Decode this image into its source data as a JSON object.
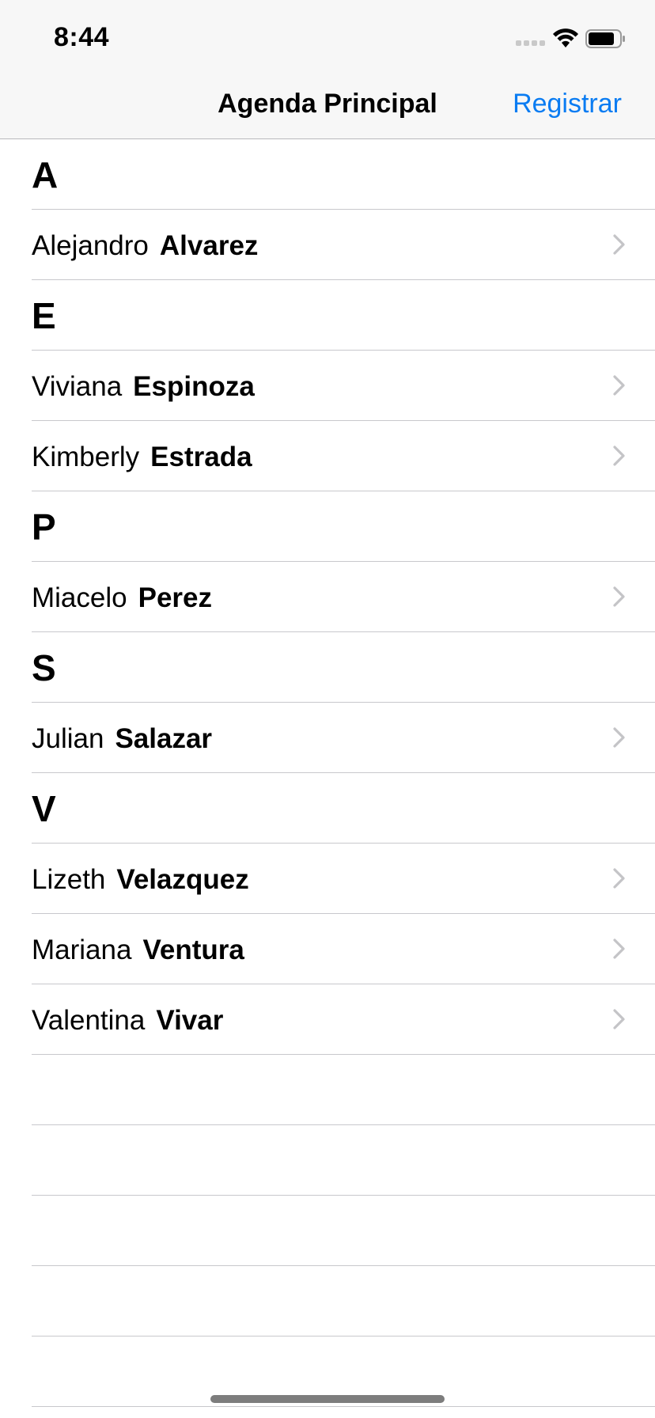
{
  "status_bar": {
    "time": "8:44",
    "icons": [
      "signal-dots-icon",
      "wifi-icon",
      "battery-icon"
    ]
  },
  "nav": {
    "title": "Agenda Principal",
    "action_label": "Registrar",
    "accent_color": "#0a7cf2"
  },
  "sections": [
    {
      "letter": "A",
      "contacts": [
        {
          "first": "Alejandro",
          "last": "Alvarez"
        }
      ]
    },
    {
      "letter": "E",
      "contacts": [
        {
          "first": "Viviana",
          "last": "Espinoza"
        },
        {
          "first": "Kimberly",
          "last": "Estrada"
        }
      ]
    },
    {
      "letter": "P",
      "contacts": [
        {
          "first": "Miacelo",
          "last": "Perez"
        }
      ]
    },
    {
      "letter": "S",
      "contacts": [
        {
          "first": "Julian",
          "last": "Salazar"
        }
      ]
    },
    {
      "letter": "V",
      "contacts": [
        {
          "first": "Lizeth",
          "last": "Velazquez"
        },
        {
          "first": "Mariana",
          "last": "Ventura"
        },
        {
          "first": "Valentina",
          "last": "Vivar"
        }
      ]
    }
  ],
  "row_accessory_icon": "chevron-right-icon"
}
